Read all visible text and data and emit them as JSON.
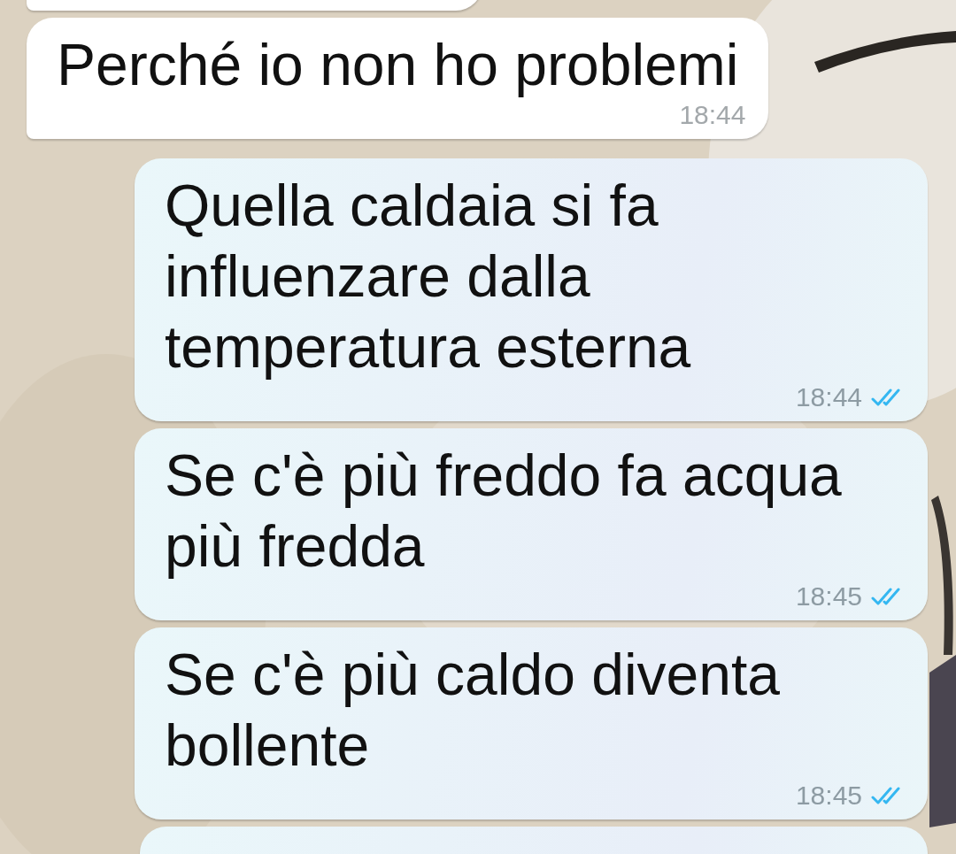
{
  "messages": [
    {
      "kind": "partial",
      "outgoing": false
    },
    {
      "kind": "text",
      "outgoing": false,
      "text": "Perché io non ho problemi",
      "time": "18:44"
    },
    {
      "kind": "text",
      "outgoing": true,
      "text": "Quella caldaia si fa influenzare dalla temperatura esterna",
      "time": "18:44",
      "read": true
    },
    {
      "kind": "text",
      "outgoing": true,
      "text": "Se c'è più freddo fa acqua più fredda",
      "time": "18:45",
      "read": true
    },
    {
      "kind": "text",
      "outgoing": true,
      "text": "Se c'è più caldo diventa bollente",
      "time": "18:45",
      "read": true
    },
    {
      "kind": "partial",
      "outgoing": true
    }
  ]
}
